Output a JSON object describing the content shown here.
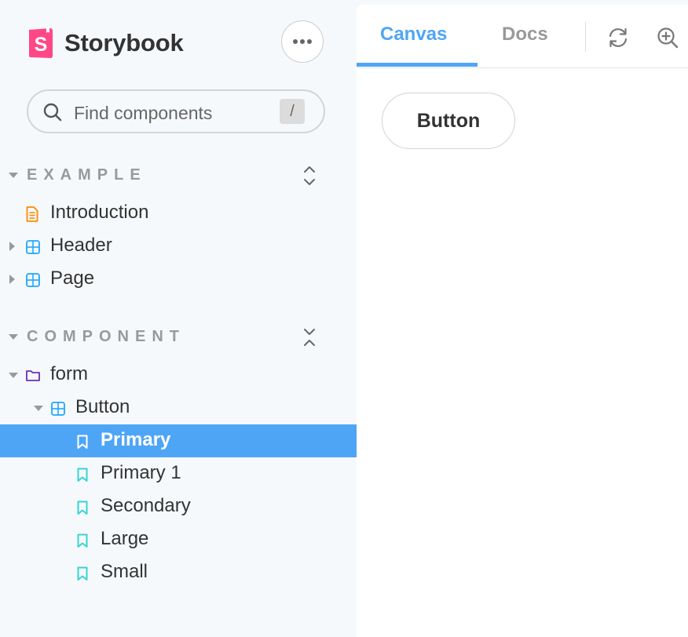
{
  "app": {
    "brand_name": "Storybook",
    "brand_color": "#ff4785",
    "accent_color": "#4fa5f5"
  },
  "sidebar": {
    "menu_icon": "ellipsis-icon",
    "search": {
      "placeholder": "Find components",
      "value": "",
      "shortcut": "/"
    },
    "sections": [
      {
        "title": "EXAMPLE",
        "expanded": true,
        "toggle_icon": "expand-all-icon",
        "items": [
          {
            "label": "Introduction",
            "kind": "document",
            "icon": "document-icon",
            "expandable": false
          },
          {
            "label": "Header",
            "kind": "component",
            "icon": "component-icon",
            "expandable": true,
            "expanded": false
          },
          {
            "label": "Page",
            "kind": "component",
            "icon": "component-icon",
            "expandable": true,
            "expanded": false
          }
        ]
      },
      {
        "title": "COMPONENT",
        "expanded": true,
        "toggle_icon": "collapse-all-icon",
        "items": [
          {
            "label": "form",
            "kind": "folder",
            "icon": "folder-icon",
            "expandable": true,
            "expanded": true
          },
          {
            "label": "Button",
            "kind": "component",
            "icon": "component-icon",
            "expandable": true,
            "expanded": true
          },
          {
            "label": "Primary",
            "kind": "story",
            "icon": "bookmark-icon",
            "selected": true
          },
          {
            "label": "Primary 1",
            "kind": "story",
            "icon": "bookmark-icon",
            "selected": false
          },
          {
            "label": "Secondary",
            "kind": "story",
            "icon": "bookmark-icon",
            "selected": false
          },
          {
            "label": "Large",
            "kind": "story",
            "icon": "bookmark-icon",
            "selected": false
          },
          {
            "label": "Small",
            "kind": "story",
            "icon": "bookmark-icon",
            "selected": false
          }
        ]
      }
    ]
  },
  "toolbar": {
    "tabs": [
      {
        "label": "Canvas",
        "active": true
      },
      {
        "label": "Docs",
        "active": false
      }
    ],
    "icons": [
      "reload-icon",
      "zoom-in-icon"
    ]
  },
  "preview": {
    "button_label": "Button"
  }
}
